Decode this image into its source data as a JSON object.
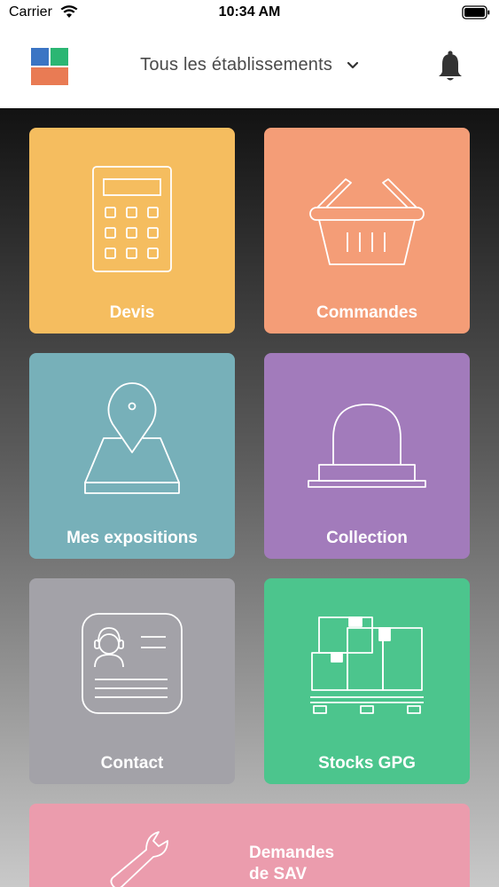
{
  "status_bar": {
    "carrier": "Carrier",
    "time": "10:34 AM"
  },
  "header": {
    "title": "Tous les établissements",
    "logo_colors": [
      "#3b75c4",
      "#2bb673",
      "#e97b54"
    ]
  },
  "tiles": [
    {
      "label": "Devis",
      "color": "#f5bd5f",
      "icon": "calculator-icon"
    },
    {
      "label": "Commandes",
      "color": "#f49d77",
      "icon": "basket-icon"
    },
    {
      "label": "Mes expositions",
      "color": "#77b0b9",
      "icon": "map-pin-icon"
    },
    {
      "label": "Collection",
      "color": "#a27bbb",
      "icon": "lamp-icon"
    },
    {
      "label": "Contact",
      "color": "#a3a2a8",
      "icon": "contact-card-icon"
    },
    {
      "label": "Stocks GPG",
      "color": "#4cc58d",
      "icon": "pallet-boxes-icon"
    },
    {
      "label": "Demandes\nde SAV",
      "label_line1": "Demandes",
      "label_line2": "de SAV",
      "color": "#eb9cad",
      "icon": "wrench-icon"
    }
  ]
}
